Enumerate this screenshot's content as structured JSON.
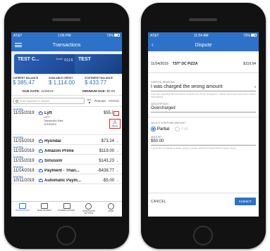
{
  "left": {
    "status": {
      "carrier": "AT&T",
      "time": "1:06 PM",
      "battery": "73%"
    },
    "title": "Transactions",
    "cards": [
      {
        "name": "TEST C...",
        "number": "**** 0116"
      },
      {
        "name": "TEST",
        "number": ""
      }
    ],
    "balances": [
      {
        "label": "CURRENT BALANCE",
        "value": "$ 385.47"
      },
      {
        "label": "AVAILABLE CREDIT",
        "value": "$ 1,114.00"
      },
      {
        "label": "STATEMENT BALANCE",
        "value": "$ 433.77"
      }
    ],
    "due": {
      "date_label": "DUE DATE:",
      "date": "11/20/19",
      "min_label": "MINIMUM DUE:",
      "min": "$0.00"
    },
    "search_placeholder": "Enter keyword or amount",
    "filters": [
      "ALL",
      "PENDING",
      "POSTED"
    ],
    "transactions": [
      {
        "status": "POSTED",
        "date": "11/15/2019",
        "merchant": "Lyft",
        "amount": "$55.0",
        "detail_name": "LYFT",
        "detail_label": "Transaction Date:",
        "detail_date": "11/15/2019",
        "action": "Dispute"
      },
      {
        "status": "POSTED",
        "date": "11/15/2019",
        "merchant": "Hyundai",
        "amount": "$73.24"
      },
      {
        "status": "POSTED",
        "date": "11/15/2019",
        "merchant": "Amazon Prime",
        "amount": "$119.00"
      },
      {
        "status": "POSTED",
        "date": "11/15/2019",
        "merchant": "Siriusxm",
        "amount": "$143.23"
      },
      {
        "status": "POSTED",
        "date": "11/14/2019",
        "merchant": "Payment - Than...",
        "amount": "-$438.77"
      },
      {
        "status": "POSTED",
        "date": "10/11/2019",
        "merchant": "Automatic Paym...",
        "amount": "-$5.00"
      }
    ],
    "tabs": [
      {
        "label": "TRANSACTIONS",
        "icon": "transactions-icon"
      },
      {
        "label": "MAKE PAYMENT",
        "icon": "payment-icon"
      },
      {
        "label": "PAYMENT HISTORY",
        "icon": "history-icon"
      },
      {
        "label": "NOTIFICATION SETTINGS",
        "icon": "gear-icon"
      },
      {
        "label": "MORE",
        "icon": "more-icon"
      }
    ]
  },
  "right": {
    "status": {
      "carrier": "AT&T",
      "time": "11:54 AM",
      "battery": "73%"
    },
    "title": "Dispute",
    "tx": {
      "date": "11/24/2019",
      "merchant": "TST* DC PIZZA",
      "amount": "$119.54"
    },
    "reason_label": "DISPUTE REASONS",
    "reason_value": "I was charged the wrong amount",
    "reason_help": "If you are disputing this transaction because you do not recognize it, please report your card lost or stolen immediately.",
    "desc_label": "DESCRIPTION",
    "desc_value": "Overcharged",
    "refund_label": "SELECT A REFUND AMOUNT",
    "refund_options": [
      "Partial",
      "Full"
    ],
    "amount_label": "AMOUNT",
    "amount_value": "$50.00",
    "amount_help": "If you'd like to indicate a lesser amount, please select the Partial Refund option above.",
    "cancel": "CANCEL",
    "submit": "SUBMIT"
  }
}
